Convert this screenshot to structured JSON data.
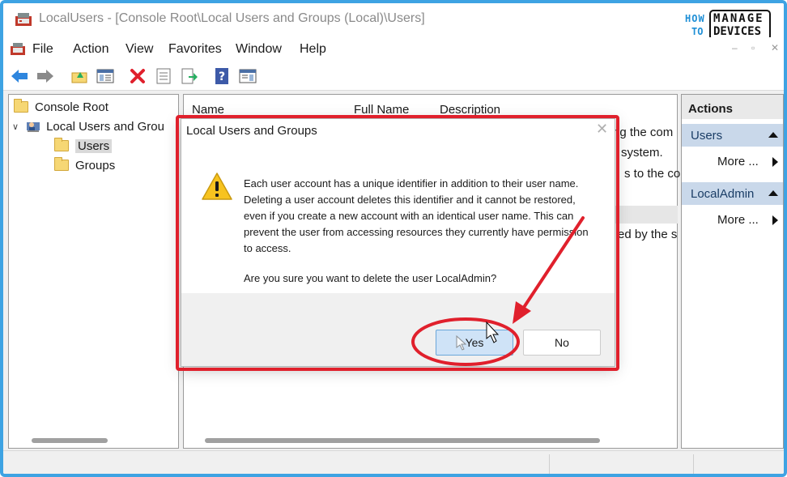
{
  "window": {
    "title": "LocalUsers - [Console Root\\Local Users and Groups (Local)\\Users]",
    "controls": [
      "–",
      "▫",
      "✕"
    ]
  },
  "brand": {
    "how": "HOW",
    "to": "TO",
    "manage": "MANAGE",
    "devices": "DEVICES",
    "colors": {
      "blue": "#1f8fd6",
      "dark": "#111111"
    }
  },
  "menu": {
    "items": [
      "File",
      "Action",
      "View",
      "Favorites",
      "Window",
      "Help"
    ]
  },
  "toolbar": {
    "icons": [
      "back-arrow-icon",
      "forward-arrow-icon",
      "up-folder-icon",
      "show-hide-tree-icon",
      "delete-icon",
      "properties-icon",
      "export-list-icon",
      "help-icon",
      "show-hide-action-pane-icon"
    ]
  },
  "tree": {
    "root": "Console Root",
    "snapin": "Local Users and Groups (Local)",
    "snapin_visible": "Local Users and Grou",
    "items": [
      "Users",
      "Groups"
    ],
    "selected": "Users"
  },
  "list": {
    "columns": [
      "Name",
      "Full Name",
      "Description"
    ],
    "visible_fragments": [
      "ng the com",
      "system.",
      "s to the co",
      "ed by the s"
    ]
  },
  "actions": {
    "header": "Actions",
    "sections": [
      {
        "title": "Users",
        "item": "More ..."
      },
      {
        "title": "LocalAdmin",
        "item": "More ..."
      }
    ]
  },
  "dialog": {
    "title": "Local Users and Groups",
    "message": "Each user account has a unique identifier in addition to their user name. Deleting a user account deletes this identifier and it cannot be restored, even if you create a new account with an identical user name. This can prevent the user from accessing resources they currently have permission to access.",
    "question": "Are you sure you want to delete the user LocalAdmin?",
    "yes_label": "Yes",
    "no_label": "No"
  },
  "annotation": {
    "color": "#e0202c"
  }
}
